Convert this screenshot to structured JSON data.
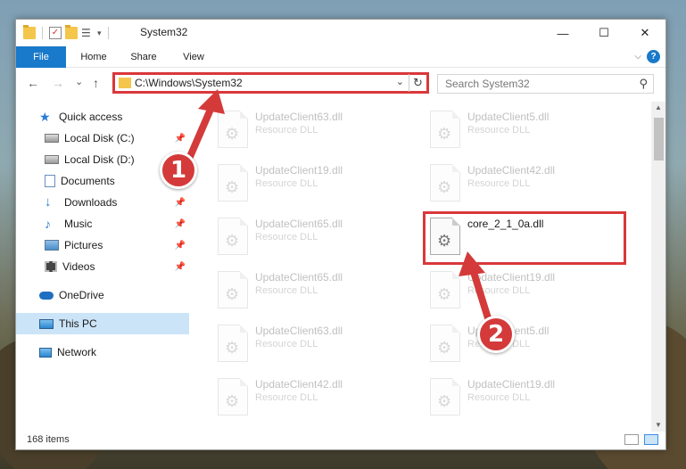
{
  "window": {
    "title": "System32",
    "controls": {
      "minimize": "—",
      "maximize": "☐",
      "close": "✕"
    }
  },
  "ribbon": {
    "tabs": [
      {
        "label": "File",
        "active": true
      },
      {
        "label": "Home"
      },
      {
        "label": "Share"
      },
      {
        "label": "View"
      }
    ],
    "help_label": "?"
  },
  "navigation": {
    "back": "←",
    "forward": "→",
    "recent": "⌄",
    "up": "↑"
  },
  "address_bar": {
    "path": "C:\\Windows\\System32",
    "dropdown": "⌄",
    "refresh": "↻"
  },
  "search": {
    "placeholder": "Search System32",
    "icon": "search-icon"
  },
  "sidebar": {
    "items": [
      {
        "label": "Quick access",
        "icon": "star-icon"
      },
      {
        "label": "Local Disk (C:)",
        "icon": "drive-icon",
        "pinned": true
      },
      {
        "label": "Local Disk (D:)",
        "icon": "drive-icon"
      },
      {
        "label": "Documents",
        "icon": "documents-icon",
        "pinned": true
      },
      {
        "label": "Downloads",
        "icon": "download-icon",
        "pinned": true
      },
      {
        "label": "Music",
        "icon": "music-icon",
        "pinned": true
      },
      {
        "label": "Pictures",
        "icon": "pictures-icon",
        "pinned": true
      },
      {
        "label": "Videos",
        "icon": "videos-icon",
        "pinned": true
      },
      {
        "label": "OneDrive",
        "icon": "cloud-icon"
      },
      {
        "label": "This PC",
        "icon": "computer-icon",
        "selected": true
      },
      {
        "label": "Network",
        "icon": "network-icon"
      }
    ]
  },
  "files": {
    "left_column": [
      {
        "name": "UpdateClient63.dll",
        "type": "Resource DLL"
      },
      {
        "name": "UpdateClient19.dll",
        "type": "Resource DLL"
      },
      {
        "name": "UpdateClient65.dll",
        "type": "Resource DLL"
      },
      {
        "name": "UpdateClient65.dll",
        "type": "Resource DLL"
      },
      {
        "name": "UpdateClient63.dll",
        "type": "Resource DLL"
      },
      {
        "name": "UpdateClient42.dll",
        "type": "Resource DLL"
      }
    ],
    "right_column": [
      {
        "name": "UpdateClient5.dll",
        "type": "Resource DLL"
      },
      {
        "name": "UpdateClient42.dll",
        "type": "Resource DLL"
      },
      {
        "name": "core_2_1_0a.dll",
        "type": ""
      },
      {
        "name": "UpdateClient19.dll",
        "type": "Resource DLL"
      },
      {
        "name": "UpdateClient5.dll",
        "type": "Resource DLL"
      },
      {
        "name": "UpdateClient19.dll",
        "type": "Resource DLL"
      }
    ]
  },
  "status": {
    "item_count": "168 items"
  },
  "annotations": {
    "badge_1": "1",
    "badge_2": "2",
    "accent_color": "#d43a3a"
  }
}
